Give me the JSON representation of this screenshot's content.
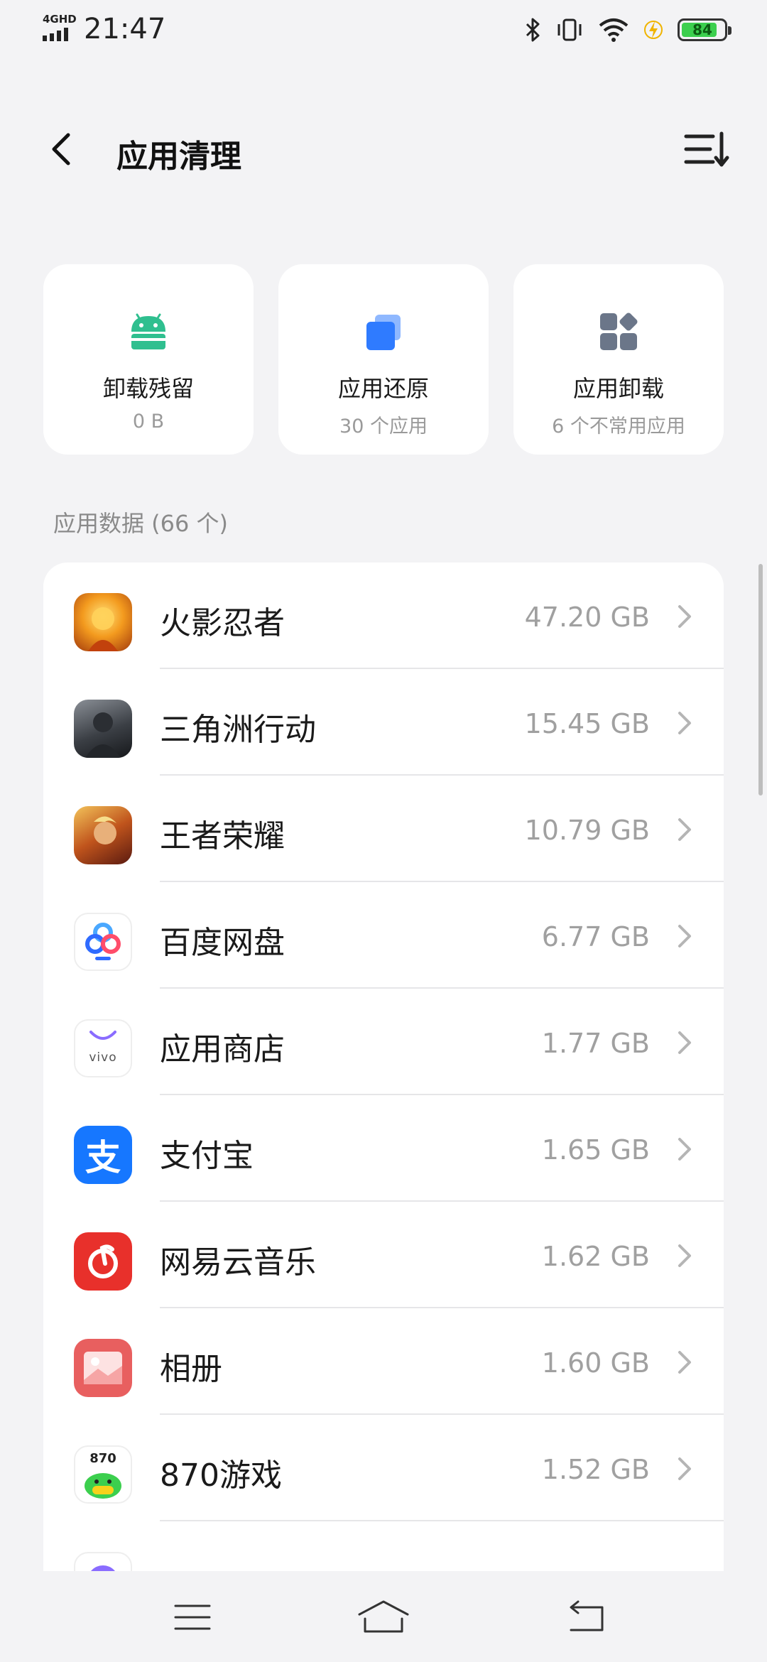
{
  "status_bar": {
    "network": "4GHD",
    "time": "21:47",
    "battery": "84",
    "battery_level": 0.84,
    "icons": [
      "bluetooth-icon",
      "vibrate-icon",
      "wifi-icon",
      "charging-icon",
      "battery-icon"
    ]
  },
  "header": {
    "title": "应用清理",
    "back_icon": "chevron-left-icon",
    "sort_icon": "sort-icon"
  },
  "cards": [
    {
      "title": "卸载残留",
      "subtitle": "0 B",
      "icon": "android-icon",
      "color": "#2FBF8F"
    },
    {
      "title": "应用还原",
      "subtitle": "30 个应用",
      "icon": "restore-icon",
      "color": "#2F7BFF"
    },
    {
      "title": "应用卸载",
      "subtitle": "6 个不常用应用",
      "icon": "apps-icon",
      "color": "#6B7689"
    }
  ],
  "section_label": "应用数据 (66 个)",
  "apps": [
    {
      "name": "火影忍者",
      "size": "47.20 GB",
      "icon": "naruto-icon"
    },
    {
      "name": "三角洲行动",
      "size": "15.45 GB",
      "icon": "delta-force-icon"
    },
    {
      "name": "王者荣耀",
      "size": "10.79 GB",
      "icon": "honor-of-kings-icon"
    },
    {
      "name": "百度网盘",
      "size": "6.77 GB",
      "icon": "baidu-netdisk-icon"
    },
    {
      "name": "应用商店",
      "size": "1.77 GB",
      "icon": "vivo-app-store-icon",
      "icon_text": "vivo"
    },
    {
      "name": "支付宝",
      "size": "1.65 GB",
      "icon": "alipay-icon",
      "icon_text": "支"
    },
    {
      "name": "网易云音乐",
      "size": "1.62 GB",
      "icon": "netease-music-icon"
    },
    {
      "name": "相册",
      "size": "1.60 GB",
      "icon": "gallery-icon"
    },
    {
      "name": "870游戏",
      "size": "1.52 GB",
      "icon": "870-game-icon",
      "icon_text": "870"
    },
    {
      "name": "",
      "size": "",
      "icon": "browser-icon"
    }
  ],
  "nav_bar": {
    "icons": [
      "menu-icon",
      "home-icon",
      "back-icon"
    ]
  }
}
